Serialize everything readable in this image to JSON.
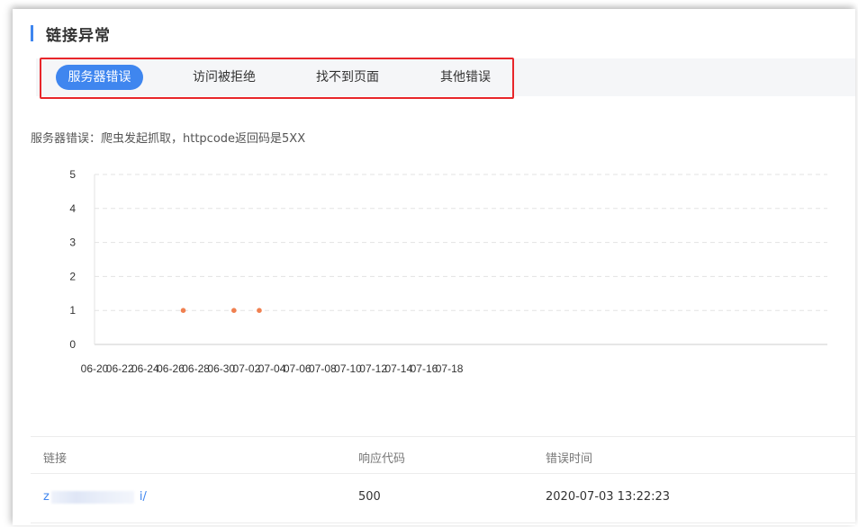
{
  "section": {
    "title": "链接异常"
  },
  "tabs": [
    {
      "label": "服务器错误",
      "active": true
    },
    {
      "label": "访问被拒绝",
      "active": false
    },
    {
      "label": "找不到页面",
      "active": false
    },
    {
      "label": "其他错误",
      "active": false
    }
  ],
  "chart_description": "服务器错误：爬虫发起抓取，httpcode返回码是5XX",
  "chart_data": {
    "type": "line",
    "title": "",
    "xlabel": "",
    "ylabel": "",
    "ylim": [
      0,
      5
    ],
    "yticks": [
      0,
      1,
      2,
      3,
      4,
      5
    ],
    "xticks": [
      "06-20",
      "06-22",
      "06-24",
      "06-26",
      "06-28",
      "06-30",
      "07-02",
      "07-04",
      "07-06",
      "07-08",
      "07-10",
      "07-12",
      "07-14",
      "07-16",
      "07-18"
    ],
    "grid": true,
    "series": [
      {
        "color": "#f08050",
        "points": [
          {
            "x": "06-27",
            "y": 1
          },
          {
            "x": "07-01",
            "y": 1
          },
          {
            "x": "07-03",
            "y": 1
          }
        ]
      }
    ]
  },
  "table": {
    "columns": [
      "链接",
      "响应代码",
      "错误时间"
    ],
    "rows": [
      {
        "link_prefix": "z",
        "link_suffix": "i/",
        "code": "500",
        "time": "2020-07-03 13:22:23"
      }
    ]
  }
}
